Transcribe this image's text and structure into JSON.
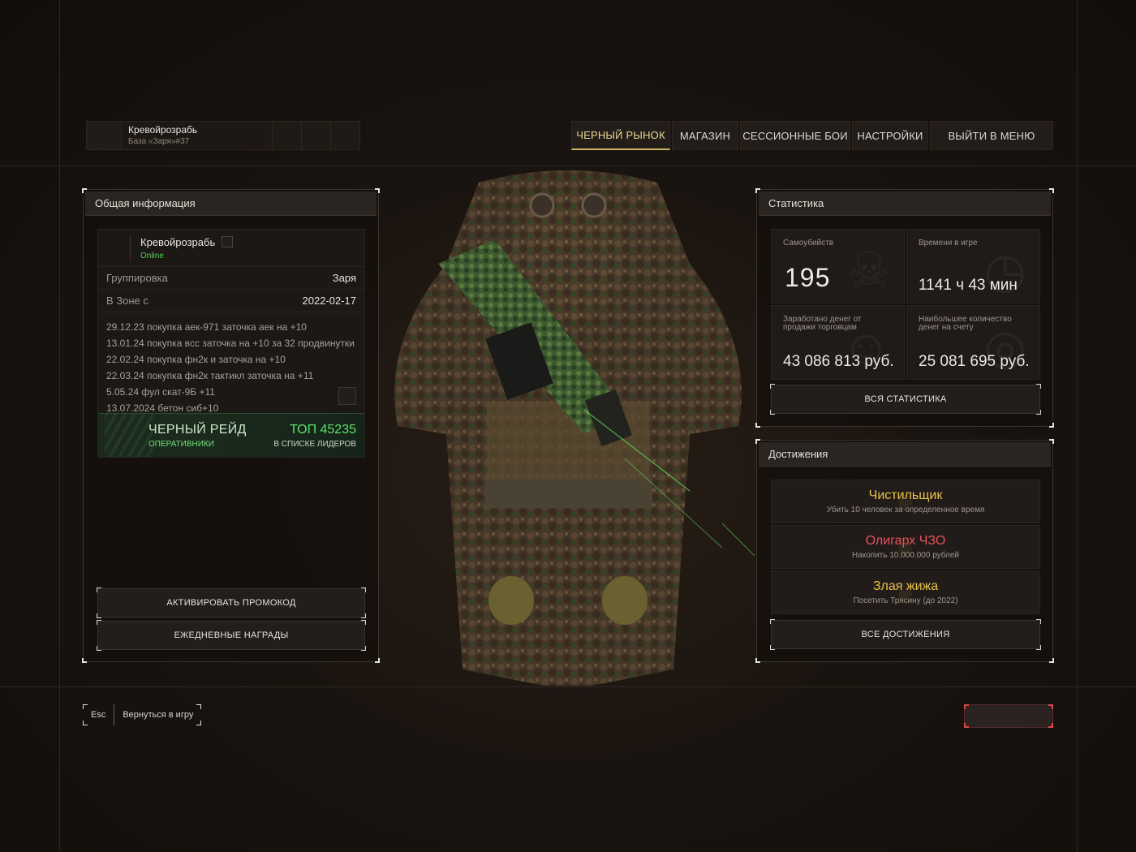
{
  "player": {
    "name": "Кревойрозрабь",
    "base": "База «Заря»#37"
  },
  "nav": [
    {
      "label": "ЧЕРНЫЙ РЫНОК",
      "active": true
    },
    {
      "label": "МАГАЗИН"
    },
    {
      "label": "СЕССИОННЫЕ БОИ"
    },
    {
      "label": "НАСТРОЙКИ"
    },
    {
      "label": "ВЫЙТИ В МЕНЮ"
    }
  ],
  "general": {
    "title": "Общая информация",
    "name": "Кревойрозрабь",
    "status": "Online",
    "faction_label": "Группировка",
    "faction_value": "Заря",
    "zone_label": "В Зоне с",
    "zone_value": "2022-02-17",
    "log": [
      "29.12.23 покупка аек-971 заточка аек на +10",
      "13.01.24 покупка всс заточка на +10 за 32 продвинутки",
      "22.02.24 покупка фн2к и заточка на +10",
      "22.03.24  покупка фн2к тактикл заточка на +11",
      "5.05.24 фул скат-9Б +11",
      "13.07.2024 бетон сиб+10"
    ],
    "raid": {
      "title": "ЧЕРНЫЙ РЕЙД",
      "subtitle": "ОПЕРАТИВНИКИ",
      "rank": "ТОП 45235",
      "rank_sub": "В СПИСКЕ ЛИДЕРОВ"
    },
    "promo_button": "АКТИВИРОВАТЬ ПРОМОКОД",
    "daily_button": "ЕЖЕДНЕВНЫЕ НАГРАДЫ"
  },
  "stats": {
    "title": "Статистика",
    "suicides_label": "Самоубийств",
    "suicides_value": "195",
    "time_label": "Времени в игре",
    "time_value": "1141 ч 43 мин",
    "earned_label": "Заработано денег от продажи торговцам",
    "earned_value": "43 086 813 руб.",
    "max_money_label": "Наибольшее количество денег на счету",
    "max_money_value": "25 081 695 руб.",
    "all_button": "ВСЯ СТАТИСТИКА"
  },
  "achievements": {
    "title": "Достижения",
    "items": [
      {
        "title": "Чистильщик",
        "desc": "Убить 10 человек за определенное время",
        "color": "#e8c24a"
      },
      {
        "title": "Олигарх ЧЗО",
        "desc": "Накопить 10.000.000 рублей",
        "color": "#e8505a"
      },
      {
        "title": "Злая жижа",
        "desc": "Посетить Трясину (до 2022)",
        "color": "#e8c24a"
      }
    ],
    "all_button": "ВСЕ ДОСТИЖЕНИЯ"
  },
  "footer": {
    "esc_key": "Esc",
    "esc_label": "Вернуться в игру"
  },
  "colors": {
    "accent_yellow": "#e6d796",
    "online_green": "#4fd24f",
    "raid_green": "#5fe06a",
    "danger_red": "#d84848"
  }
}
